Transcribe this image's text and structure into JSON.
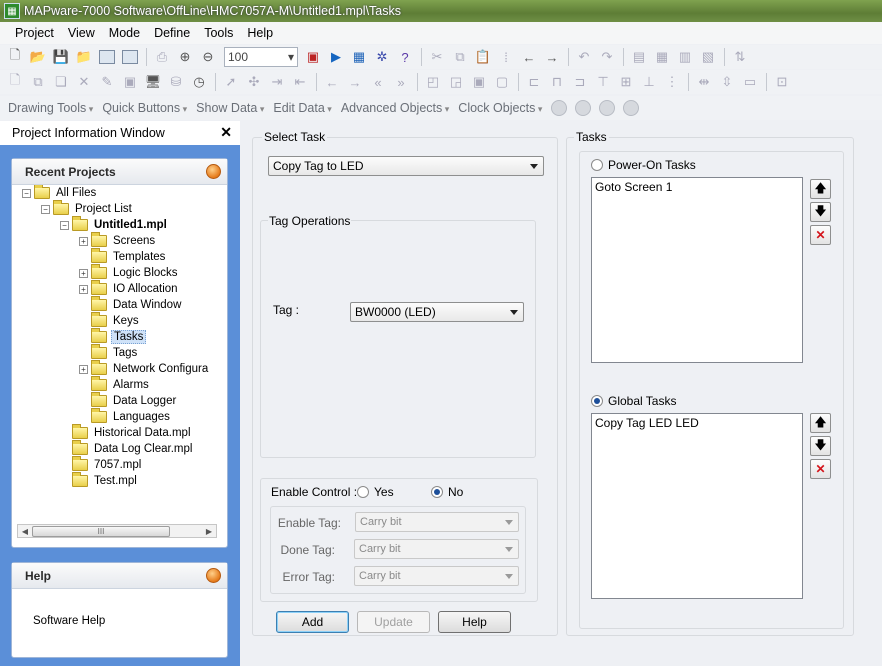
{
  "window": {
    "title": "MAPware-7000 Software\\OffLine\\HMC7057A-M\\Untitled1.mpl\\Tasks",
    "icon": "app-grid-icon"
  },
  "menu": [
    "Project",
    "View",
    "Mode",
    "Define",
    "Tools",
    "Help"
  ],
  "toolbar": {
    "zoom_value": "100"
  },
  "quickbar": [
    "Drawing Tools",
    "Quick Buttons",
    "Show Data",
    "Edit Data",
    "Advanced Objects",
    "Clock Objects"
  ],
  "project_window": {
    "title": "Project Information Window",
    "close_label": "✕",
    "recent_projects": {
      "title": "Recent Projects",
      "tree": [
        {
          "label": "All Files",
          "level": 0,
          "expander": "−"
        },
        {
          "label": "Project List",
          "level": 1,
          "expander": "−"
        },
        {
          "label": "Untitled1.mpl",
          "level": 2,
          "expander": "−",
          "bold": true
        },
        {
          "label": "Screens",
          "level": 3,
          "expander": "+"
        },
        {
          "label": "Templates",
          "level": 3,
          "expander": ""
        },
        {
          "label": "Logic Blocks",
          "level": 3,
          "expander": "+"
        },
        {
          "label": "IO Allocation",
          "level": 3,
          "expander": "+"
        },
        {
          "label": "Data Window",
          "level": 3,
          "expander": ""
        },
        {
          "label": "Keys",
          "level": 3,
          "expander": ""
        },
        {
          "label": "Tasks",
          "level": 3,
          "expander": "",
          "selected": true
        },
        {
          "label": "Tags",
          "level": 3,
          "expander": ""
        },
        {
          "label": "Network Configura",
          "level": 3,
          "expander": "+"
        },
        {
          "label": "Alarms",
          "level": 3,
          "expander": ""
        },
        {
          "label": "Data Logger",
          "level": 3,
          "expander": ""
        },
        {
          "label": "Languages",
          "level": 3,
          "expander": ""
        },
        {
          "label": "Historical Data.mpl",
          "level": 2,
          "expander": ""
        },
        {
          "label": "Data Log Clear.mpl",
          "level": 2,
          "expander": ""
        },
        {
          "label": "7057.mpl",
          "level": 2,
          "expander": ""
        },
        {
          "label": "Test.mpl",
          "level": 2,
          "expander": ""
        }
      ],
      "scroll_thumb": "III"
    },
    "help": {
      "title": "Help",
      "link": "Software Help"
    }
  },
  "select_task": {
    "label": "Select Task",
    "value": "Copy Tag to LED",
    "tag_operations": {
      "label": "Tag Operations",
      "tag_label": "Tag :",
      "tag_value": "BW0000 (LED)"
    },
    "enable_control": {
      "label": "Enable Control :",
      "yes": "Yes",
      "no": "No",
      "selected": "No",
      "enable_tag_label": "Enable Tag:",
      "enable_tag_value": "Carry bit",
      "done_tag_label": "Done Tag:",
      "done_tag_value": "Carry bit",
      "error_tag_label": "Error Tag:",
      "error_tag_value": "Carry bit"
    },
    "buttons": {
      "add": "Add",
      "update": "Update",
      "help": "Help"
    }
  },
  "tasks": {
    "label": "Tasks",
    "power_on": {
      "label": "Power-On Tasks",
      "selected": false,
      "items": [
        "Goto Screen 1"
      ]
    },
    "global": {
      "label": "Global Tasks",
      "selected": true,
      "items": [
        "Copy Tag LED LED"
      ]
    },
    "up_symbol": "🡅",
    "down_symbol": "🡇",
    "delete_symbol": "✕"
  }
}
